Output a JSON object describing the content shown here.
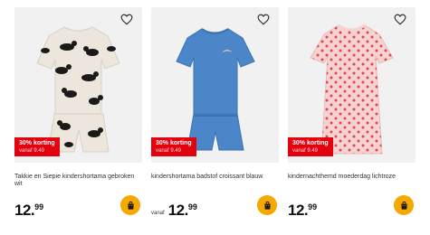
{
  "products": [
    {
      "title": "Takkie en Siepie kindershortama gebroken wit",
      "discount": "30% korting",
      "was_price": "vanaf 9.49",
      "price_prefix": "",
      "price_main": "12.",
      "price_cents": "99",
      "image_icon": "pajama-cats-print",
      "colors": {
        "fabric": "#ece6dc",
        "print": "#1a1a1a"
      }
    },
    {
      "title": "kindershortama badstof croissant blauw",
      "discount": "30% korting",
      "was_price": "vanaf 9.49",
      "price_prefix": "vanaf",
      "price_main": "12.",
      "price_cents": "99",
      "image_icon": "pajama-blue-terry",
      "colors": {
        "fabric": "#4a86c8"
      }
    },
    {
      "title": "kindernachthemd moederdag lichtroze",
      "discount": "30% korting",
      "was_price": "vanaf 9.49",
      "price_prefix": "",
      "price_main": "12.",
      "price_cents": "99",
      "image_icon": "nightgown-pink-hearts",
      "colors": {
        "fabric": "#f6d3d3",
        "print": "#e2434f"
      }
    }
  ],
  "icons": {
    "favorite": "heart-outline-icon",
    "cart": "shopping-bag-icon"
  },
  "colors": {
    "badge": "#e3000f",
    "cart_button": "#f5a800",
    "image_bg": "#f1f1f1"
  }
}
